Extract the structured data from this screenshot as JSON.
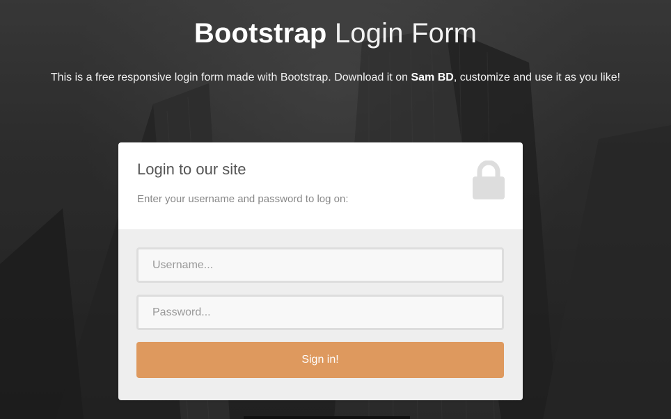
{
  "header": {
    "title_bold": "Bootstrap",
    "title_light": "Login Form",
    "description_before": "This is a free responsive login form made with Bootstrap. Download it on ",
    "description_link": "Sam BD",
    "description_after": ", customize and use it as you like!"
  },
  "form": {
    "title": "Login to our site",
    "subtitle": "Enter your username and password to log on:",
    "icon": "lock-icon",
    "username": {
      "placeholder": "Username...",
      "value": ""
    },
    "password": {
      "placeholder": "Password...",
      "value": ""
    },
    "submit_label": "Sign in!"
  },
  "colors": {
    "accent": "#de995e",
    "form_top_bg": "#ffffff",
    "form_bottom_bg": "#eeeeee",
    "icon_color": "#dddddd"
  }
}
